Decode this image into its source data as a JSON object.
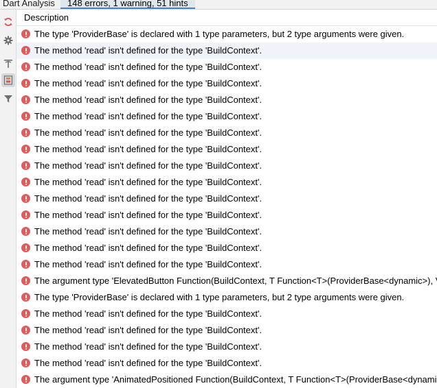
{
  "tabs": {
    "title": "Dart Analysis",
    "active_label": "148 errors, 1 warning, 51 hints"
  },
  "toolbar": {
    "icons": [
      "refresh-icon",
      "gear-icon",
      "autoscroll-icon",
      "group-by-severity-icon",
      "filter-icon"
    ],
    "selected": "group-by-severity-icon",
    "colors": {
      "refresh": "#e0504f",
      "gray": "#6e6e6e",
      "orange": "#e08a2c"
    }
  },
  "table": {
    "header": "Description",
    "rows": [
      "The type 'ProviderBase' is declared with 1 type parameters, but 2 type arguments were given.",
      "The method 'read' isn't defined for the type 'BuildContext'.",
      "The method 'read' isn't defined for the type 'BuildContext'.",
      "The method 'read' isn't defined for the type 'BuildContext'.",
      "The method 'read' isn't defined for the type 'BuildContext'.",
      "The method 'read' isn't defined for the type 'BuildContext'.",
      "The method 'read' isn't defined for the type 'BuildContext'.",
      "The method 'read' isn't defined for the type 'BuildContext'.",
      "The method 'read' isn't defined for the type 'BuildContext'.",
      "The method 'read' isn't defined for the type 'BuildContext'.",
      "The method 'read' isn't defined for the type 'BuildContext'.",
      "The method 'read' isn't defined for the type 'BuildContext'.",
      "The method 'read' isn't defined for the type 'BuildContext'.",
      "The method 'read' isn't defined for the type 'BuildContext'.",
      "The method 'read' isn't defined for the type 'BuildContext'.",
      "The argument type 'ElevatedButton Function(BuildContext, T Function<T>(ProviderBase<dynamic>), V",
      "The type 'ProviderBase' is declared with 1 type parameters, but 2 type arguments were given.",
      "The method 'read' isn't defined for the type 'BuildContext'.",
      "The method 'read' isn't defined for the type 'BuildContext'.",
      "The method 'read' isn't defined for the type 'BuildContext'.",
      "The method 'read' isn't defined for the type 'BuildContext'.",
      "The argument type 'AnimatedPositioned Function(BuildContext, T Function<T>(ProviderBase<dynami"
    ],
    "selected_row": 1,
    "severity_color": "#e25a5a"
  }
}
